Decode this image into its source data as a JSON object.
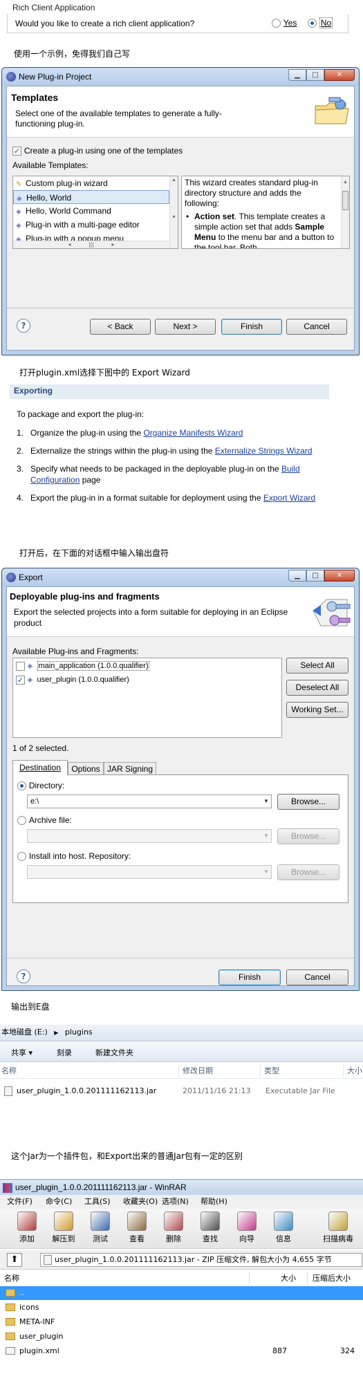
{
  "rcp": {
    "title": "Rich Client Application",
    "question": "Would you like to create a rich client application?",
    "yes": "Yes",
    "no": "No"
  },
  "caption1": "使用一个示例，免得我们自己写",
  "wizard": {
    "title": "New Plug-in Project",
    "header": "Templates",
    "desc": "Select one of the available templates to generate a fully-functioning plug-in.",
    "create_check": "Create a plug-in using one of the templates",
    "available": "Available Templates:",
    "templates": [
      "Custom plug-in wizard",
      "Hello, World",
      "Hello, World Command",
      "Plug-in with a multi-page editor",
      "Plug-in with a popup menu"
    ],
    "desc_intro": "This wizard creates standard plug-in directory structure and adds the following:",
    "desc_bullet_bold": "Action set",
    "desc_bullet_text": ". This template creates a simple action set that adds ",
    "desc_bullet_bold2": "Sample Menu",
    "desc_bullet_text2": " to the menu bar and a button to the tool bar. Both",
    "back": "< Back",
    "next": "Next >",
    "finish": "Finish",
    "cancel": "Cancel"
  },
  "caption2": "打开plugin.xml选择下图中的 Export Wizard",
  "exporting": {
    "title": "Exporting",
    "intro": "To package and export the plug-in:",
    "steps": [
      {
        "pre": "Organize the plug-in using the ",
        "link": "Organize Manifests Wizard",
        "post": ""
      },
      {
        "pre": "Externalize the strings within the plug-in using the ",
        "link": "Externalize Strings Wizard",
        "post": ""
      },
      {
        "pre": "Specify what needs to be packaged in the deployable plug-in on the ",
        "link": "Build Configuration",
        "post": " page"
      },
      {
        "pre": "Export the plug-in in a format suitable for deployment using the ",
        "link": "Export Wizard",
        "post": ""
      }
    ]
  },
  "caption3": "打开后，在下面的对话框中输入输出盘符",
  "export": {
    "title": "Export",
    "header": "Deployable plug-ins and fragments",
    "desc": "Export the selected projects into a form suitable for deploying in an Eclipse product",
    "available": "Available Plug-ins and Fragments:",
    "items": [
      "main_application (1.0.0.qualifier)",
      "user_plugin (1.0.0.qualifier)"
    ],
    "select_all": "Select All",
    "deselect_all": "Deselect All",
    "working_set": "Working Set...",
    "status": "1 of 2 selected.",
    "tabs": [
      "Destination",
      "Options",
      "JAR Signing"
    ],
    "directory": "Directory:",
    "directory_value": "e:\\",
    "archive": "Archive file:",
    "install": "Install into host. Repository:",
    "browse": "Browse...",
    "finish": "Finish",
    "cancel": "Cancel"
  },
  "caption4": "输出到E盘",
  "explorer": {
    "path_drive": "本地磁盘 (E:)",
    "path_folder": "plugins",
    "toolbar": [
      "共享 ▾",
      "刻录",
      "新建文件夹"
    ],
    "cols": [
      "名称",
      "修改日期",
      "类型",
      "大小"
    ],
    "row": {
      "name": "user_plugin_1.0.0.201111162113.jar",
      "date": "2011/11/16 21:13",
      "type": "Executable Jar File"
    }
  },
  "caption5": "这个Jar为一个插件包，和Export出来的普通Jar包有一定的区别",
  "winrar": {
    "title": "user_plugin_1.0.0.201111162113.jar - WinRAR",
    "menu": [
      "文件(F)",
      "命令(C)",
      "工具(S)",
      "收藏夹(O)",
      "选项(N)",
      "帮助(H)"
    ],
    "tools": [
      "添加",
      "解压到",
      "测试",
      "查看",
      "删除",
      "查找",
      "向导",
      "信息",
      "扫描病毒"
    ],
    "path": "user_plugin_1.0.0.201111162113.jar - ZIP 压缩文件, 解包大小为 4,655 字节",
    "cols": [
      "名称",
      "大小",
      "压缩后大小"
    ],
    "rows": [
      {
        "name": "..",
        "size": "",
        "packed": ""
      },
      {
        "name": "icons",
        "size": "",
        "packed": ""
      },
      {
        "name": "META-INF",
        "size": "",
        "packed": ""
      },
      {
        "name": "user_plugin",
        "size": "",
        "packed": ""
      },
      {
        "name": "plugin.xml",
        "size": "887",
        "packed": "324"
      }
    ]
  }
}
